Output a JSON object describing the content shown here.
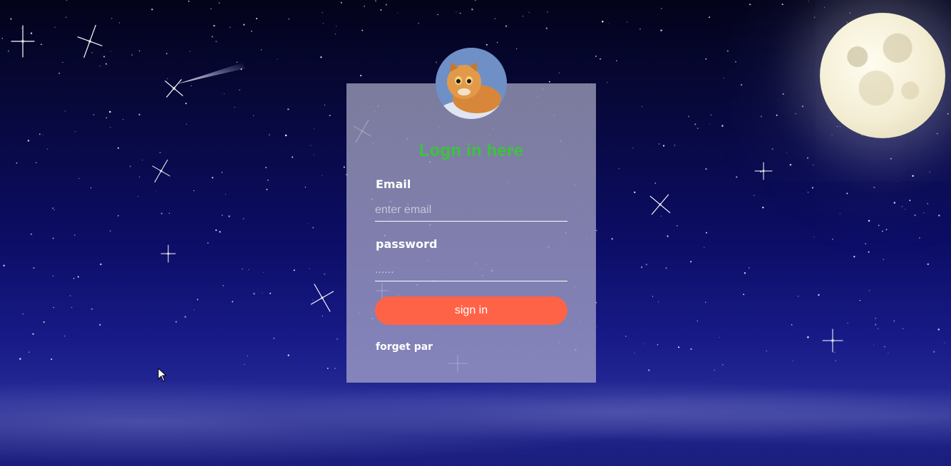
{
  "login": {
    "title": "Logn in here",
    "email_label": "Email",
    "email_placeholder": "enter email",
    "password_label": "password",
    "password_placeholder": "......",
    "signin_label": "sign in",
    "forget_label": "forget par"
  },
  "colors": {
    "title_green": "#3cc43c",
    "button_tomato": "#ff6347",
    "sky_dark": "#03031a",
    "sky_blue": "#0c0d66"
  },
  "icons": {
    "avatar": "cat-avatar",
    "moon": "moon",
    "cursor": "mouse-pointer-icon"
  }
}
